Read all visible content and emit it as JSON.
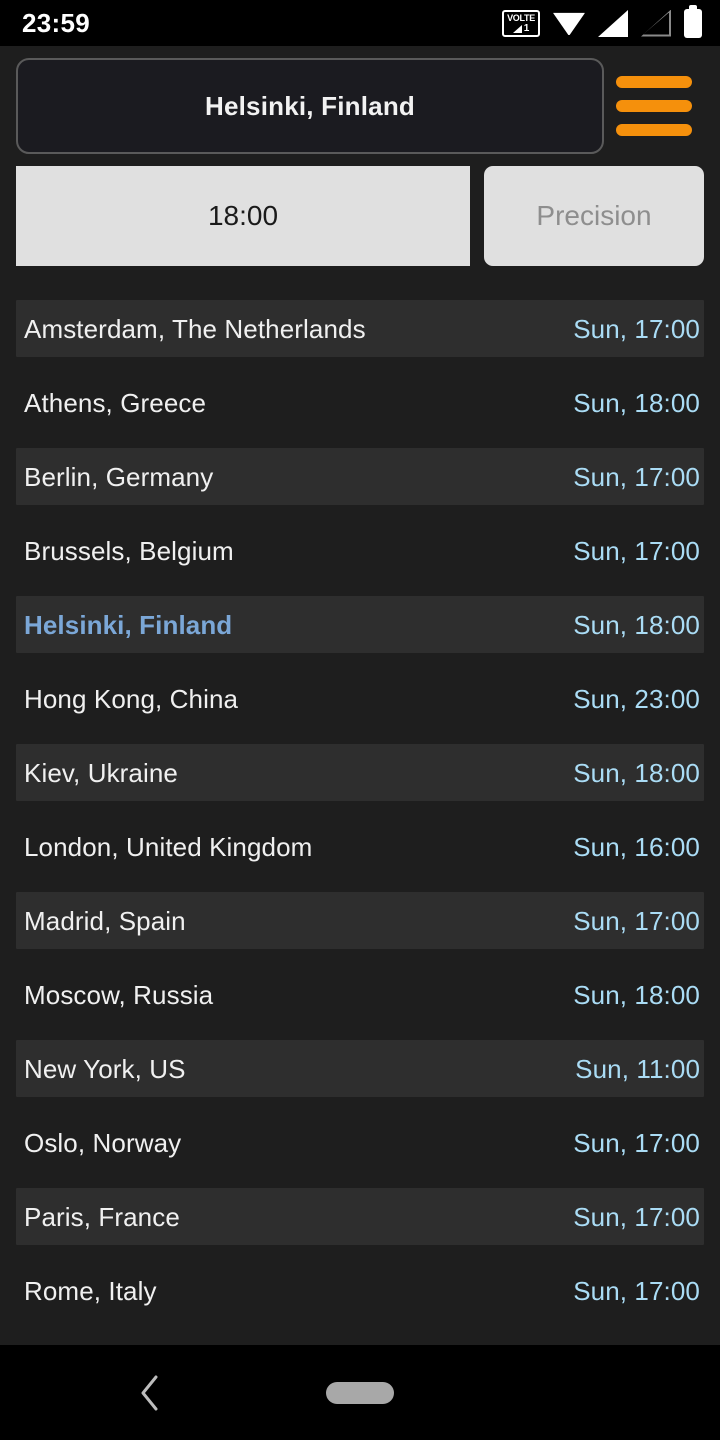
{
  "statusbar": {
    "time": "23:59",
    "icons": [
      {
        "name": "volte-icon",
        "label_top": "VOLTE",
        "label_bottom": "1"
      },
      {
        "name": "wifi-icon"
      },
      {
        "name": "cellular-signal-icon"
      },
      {
        "name": "cellular-signal-empty-icon"
      },
      {
        "name": "battery-icon"
      }
    ]
  },
  "header": {
    "city_value": "Helsinki, Finland",
    "city_placeholder": "Helsinki, Finland",
    "menu_icon": "hamburger-menu-icon",
    "menu_color": "#f5900c"
  },
  "controls": {
    "time_label": "18:00",
    "precision_label": "Precision"
  },
  "theme": {
    "background": "#1e1e1e",
    "stripe": "#2e2e2e",
    "time_accent": "#aadcf5",
    "selected_accent": "#7ba7d7",
    "button_face": "#e0e0e0"
  },
  "list": {
    "rows": [
      {
        "city": "Amsterdam, The Netherlands",
        "time": "Sun, 17:00",
        "selected": false
      },
      {
        "city": "Athens, Greece",
        "time": "Sun, 18:00",
        "selected": false
      },
      {
        "city": "Berlin, Germany",
        "time": "Sun, 17:00",
        "selected": false
      },
      {
        "city": "Brussels, Belgium",
        "time": "Sun, 17:00",
        "selected": false
      },
      {
        "city": "Helsinki, Finland",
        "time": "Sun, 18:00",
        "selected": true
      },
      {
        "city": "Hong Kong, China",
        "time": "Sun, 23:00",
        "selected": false
      },
      {
        "city": "Kiev, Ukraine",
        "time": "Sun, 18:00",
        "selected": false
      },
      {
        "city": "London, United Kingdom",
        "time": "Sun, 16:00",
        "selected": false
      },
      {
        "city": "Madrid, Spain",
        "time": "Sun, 17:00",
        "selected": false
      },
      {
        "city": "Moscow, Russia",
        "time": "Sun, 18:00",
        "selected": false
      },
      {
        "city": "New York, US",
        "time": "Sun, 11:00",
        "selected": false
      },
      {
        "city": "Oslo, Norway",
        "time": "Sun, 17:00",
        "selected": false
      },
      {
        "city": "Paris, France",
        "time": "Sun, 17:00",
        "selected": false
      },
      {
        "city": "Rome, Italy",
        "time": "Sun, 17:00",
        "selected": false
      }
    ]
  },
  "navbar": {
    "back_icon": "chevron-left-icon",
    "home_indicator": "home-pill-indicator"
  }
}
